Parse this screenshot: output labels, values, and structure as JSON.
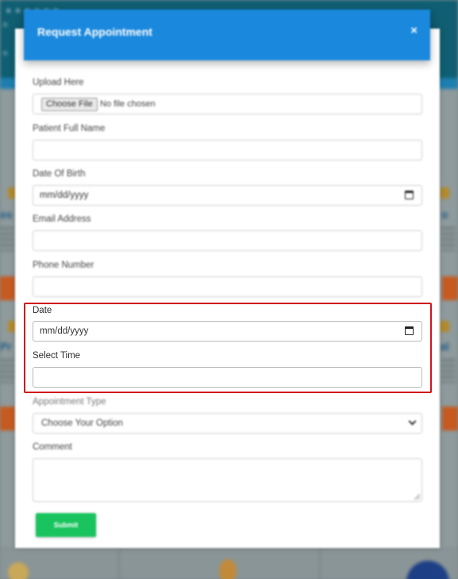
{
  "modal": {
    "title": "Request Appointment",
    "close_symbol": "×"
  },
  "fields": {
    "upload": {
      "label": "Upload Here",
      "button": "Choose File",
      "status": "No file chosen"
    },
    "patient_name": {
      "label": "Patient Full Name",
      "value": ""
    },
    "dob": {
      "label": "Date Of Birth",
      "placeholder": "mm/dd/yyyy"
    },
    "email": {
      "label": "Email Address",
      "value": ""
    },
    "phone": {
      "label": "Phone Number",
      "value": ""
    },
    "date": {
      "label": "Date",
      "placeholder": "mm/dd/yyyy"
    },
    "time": {
      "label": "Select Time",
      "value": ""
    },
    "appointment_type": {
      "label": "Appointment Type",
      "selected": "Choose Your Option"
    },
    "comment": {
      "label": "Comment",
      "value": ""
    }
  },
  "submit_label": "Submit",
  "colors": {
    "header": "#1a88dc",
    "submit": "#19c45e",
    "highlight": "#d0141b"
  }
}
